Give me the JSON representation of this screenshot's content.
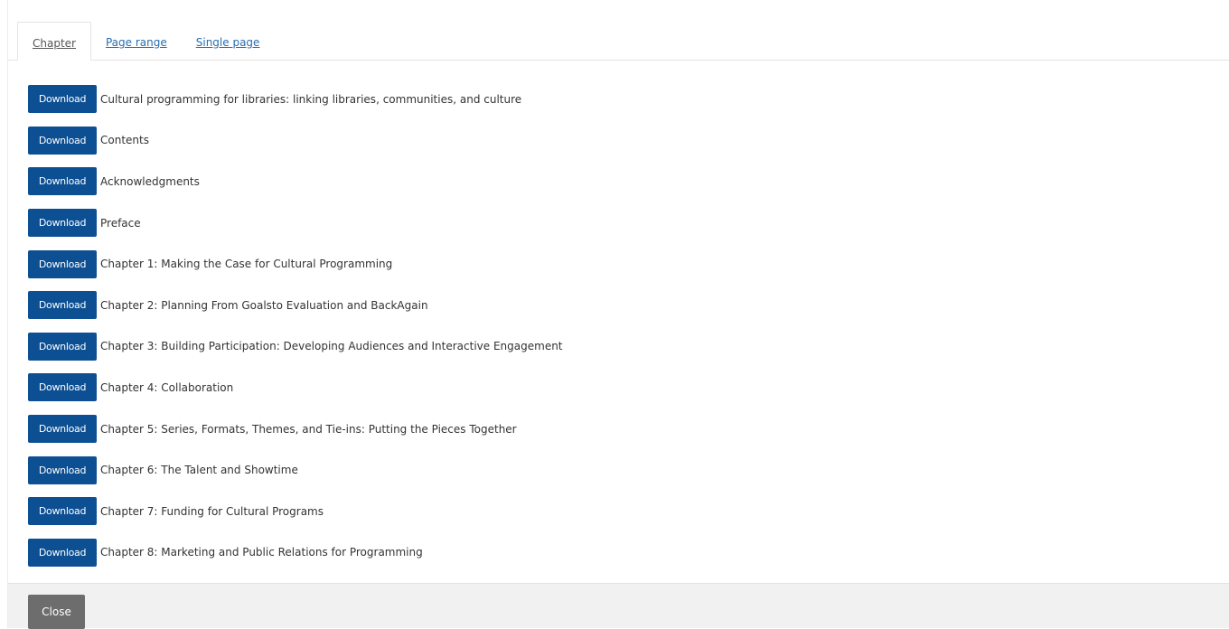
{
  "tabs": [
    {
      "label": "Chapter",
      "active": true
    },
    {
      "label": "Page range",
      "active": false
    },
    {
      "label": "Single page",
      "active": false
    }
  ],
  "download_label": "Download",
  "chapters": [
    {
      "title": "Cultural programming for libraries: linking libraries, communities, and culture"
    },
    {
      "title": "Contents"
    },
    {
      "title": "Acknowledgments"
    },
    {
      "title": "Preface"
    },
    {
      "title": "Chapter 1: Making the Case for Cultural Programming"
    },
    {
      "title": "Chapter 2: Planning From Goalsto Evaluation and BackAgain"
    },
    {
      "title": "Chapter 3: Building Participation: Developing Audiences and Interactive Engagement"
    },
    {
      "title": "Chapter 4: Collaboration"
    },
    {
      "title": "Chapter 5: Series, Formats, Themes, and Tie-ins: Putting the Pieces Together"
    },
    {
      "title": "Chapter 6: The Talent and Showtime"
    },
    {
      "title": "Chapter 7: Funding for Cultural Programs"
    },
    {
      "title": "Chapter 8: Marketing and Public Relations for Programming"
    }
  ],
  "footer": {
    "close_label": "Close"
  },
  "colors": {
    "download_button": "#0d4f93",
    "tab_link": "#2a6db0",
    "close_button": "#6d6d6d"
  }
}
